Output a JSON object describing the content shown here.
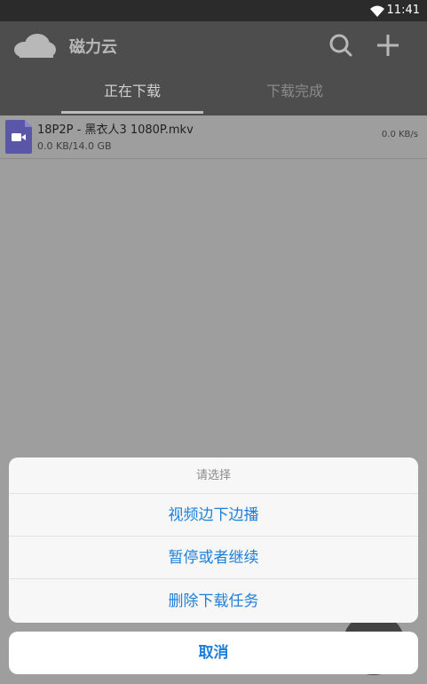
{
  "status_bar": {
    "time": "11:41",
    "wifi_icon": "wifi-icon"
  },
  "app_bar": {
    "title": "磁力云",
    "logo_icon": "cloud-icon",
    "search_icon": "search-icon",
    "add_icon": "plus-icon"
  },
  "tabs": [
    {
      "label": "正在下载",
      "active": true
    },
    {
      "label": "下载完成",
      "active": false
    }
  ],
  "downloads": [
    {
      "icon": "video-file-icon",
      "name": "18P2P - 黑衣人3 1080P.mkv",
      "size": "0.0 KB/14.0 GB",
      "speed": "0.0 KB/s"
    }
  ],
  "action_sheet": {
    "title": "请选择",
    "options": [
      "视频边下边播",
      "暂停或者继续",
      "删除下载任务"
    ],
    "cancel_label": "取消"
  },
  "colors": {
    "accent": "#1e7fd8",
    "app_bar": "#4d4d4d",
    "file_icon": "#5a56a8"
  }
}
